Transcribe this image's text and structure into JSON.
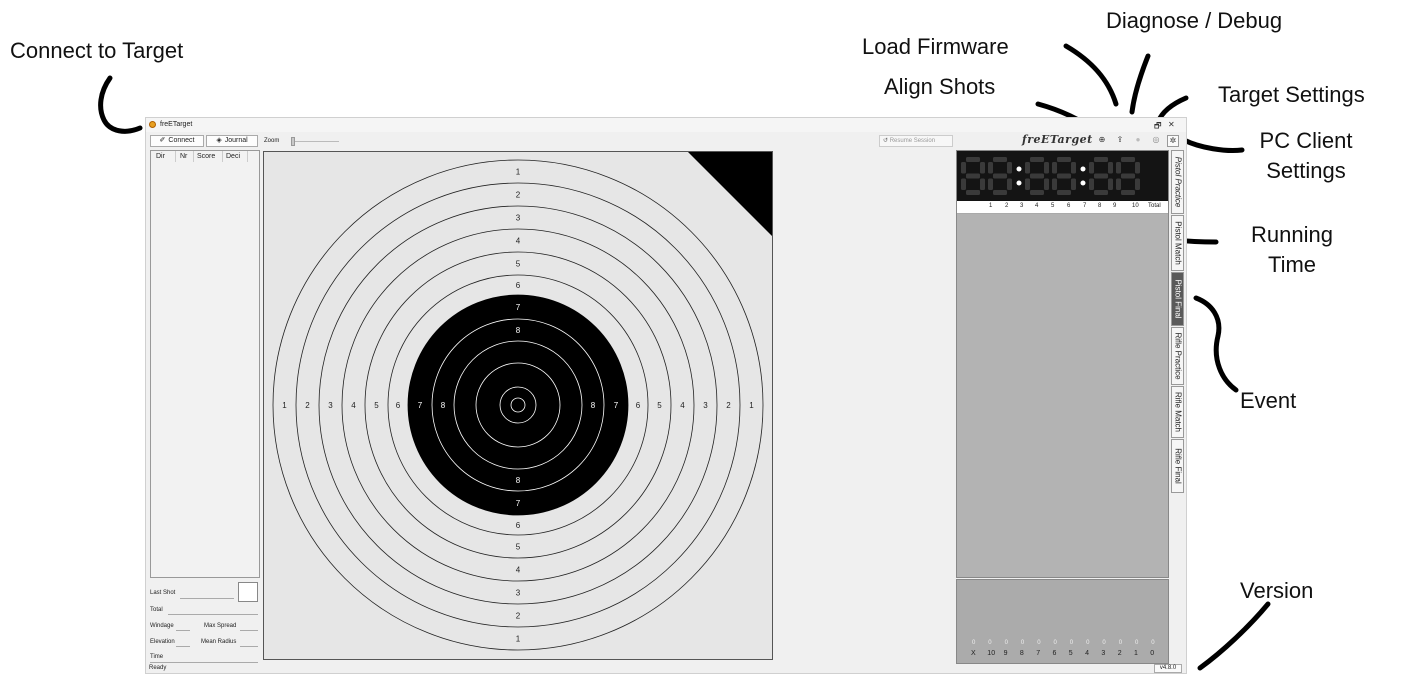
{
  "annotations": {
    "connect_to_target": "Connect to Target",
    "load_firmware": "Load Firmware",
    "diagnose_debug": "Diagnose / Debug",
    "align_shots": "Align Shots",
    "target_settings": "Target Settings",
    "pc_client_settings_1": "PC Client",
    "pc_client_settings_2": "Settings",
    "running_time_1": "Running",
    "running_time_2": "Time",
    "event": "Event",
    "version": "Version"
  },
  "window": {
    "title": "freETarget",
    "restore_glyph": "🗗",
    "close_glyph": "✕"
  },
  "toolbar": {
    "connect_label": "Connect",
    "connect_icon": "plug-icon",
    "journal_label": "Journal",
    "journal_icon": "journal-icon",
    "zoom_label": "Zoom",
    "zoom_value": 0,
    "resume_label": "Resume Session",
    "logo_text": "freETarget",
    "icons": [
      "align-shots-icon",
      "load-firmware-icon",
      "diagnose-icon",
      "target-settings-icon",
      "pc-client-settings-icon"
    ]
  },
  "shot_list": {
    "columns": [
      "Dir",
      "Nr",
      "Score",
      "Deci"
    ]
  },
  "stats": {
    "last_shot": "Last Shot",
    "total": "Total",
    "windage": "Windage",
    "max_spread": "Max Spread",
    "elevation": "Elevation",
    "mean_radius": "Mean Radius",
    "time": "Time"
  },
  "status": {
    "ready": "Ready",
    "version": "v4.8.0"
  },
  "target": {
    "ring_numbers": [
      "1",
      "2",
      "3",
      "4",
      "5",
      "6",
      "7",
      "8"
    ],
    "black_from_ring": 7,
    "colors": {
      "paper": "#e6e6e6",
      "black": "#000000"
    }
  },
  "clock": {
    "digits": "88:88:88",
    "digit_color": "#3a3a3a"
  },
  "shot_numbers": [
    "1",
    "2",
    "3",
    "4",
    "5",
    "6",
    "7",
    "8",
    "9",
    "10",
    "Total"
  ],
  "histogram": {
    "categories": [
      "X",
      "10",
      "9",
      "8",
      "7",
      "6",
      "5",
      "4",
      "3",
      "2",
      "1",
      "0"
    ],
    "counts": [
      "0",
      "0",
      "0",
      "0",
      "0",
      "0",
      "0",
      "0",
      "0",
      "0",
      "0",
      "0"
    ]
  },
  "event_tabs": [
    {
      "label": "Pistol Practice",
      "selected": false
    },
    {
      "label": "Pistol Match",
      "selected": false
    },
    {
      "label": "Pistol Final",
      "selected": true
    },
    {
      "label": "Rifle Practice",
      "selected": false
    },
    {
      "label": "Rifle Match",
      "selected": false
    },
    {
      "label": "Rifle Final",
      "selected": false
    }
  ]
}
